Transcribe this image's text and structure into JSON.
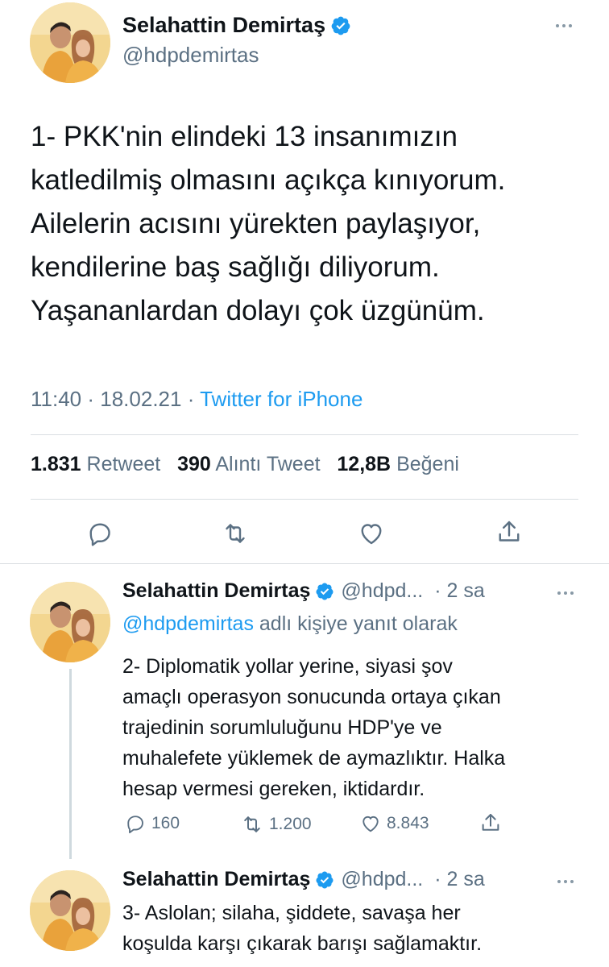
{
  "main_tweet": {
    "display_name": "Selahattin Demirtaş",
    "handle": "@hdpdemirtas",
    "text": "1- PKK'nin elindeki 13 insanımızın\nkatledilmiş olmasını açıkça kınıyorum.\nAilelerin acısını yürekten paylaşıyor,\nkendilerine baş sağlığı diliyorum.\nYaşananlardan dolayı çok üzgünüm.",
    "time": "11:40",
    "separator1": " · ",
    "date": "18.02.21",
    "separator2": " · ",
    "source": "Twitter for iPhone",
    "stats": {
      "retweets_count": "1.831",
      "retweets_label": "Retweet",
      "quotes_count": "390",
      "quotes_label": "Alıntı Tweet",
      "likes_count": "12,8B",
      "likes_label": "Beğeni"
    }
  },
  "replies": [
    {
      "display_name": "Selahattin Demirtaş",
      "handle": "@hdpd...",
      "time": "· 2 sa",
      "reply_to_handle": "@hdpdemirtas",
      "reply_to_suffix": " adlı kişiye yanıt olarak",
      "text": "2- Diplomatik yollar yerine, siyasi şov\namaçlı operasyon sonucunda ortaya çıkan\ntrajedinin sorumluluğunu HDP'ye ve\nmuhalefete yüklemek de aymazlıktır. Halka\nhesap vermesi gereken, iktidardır.",
      "reply_count": "160",
      "retweet_count": "1.200",
      "like_count": "8.843"
    },
    {
      "display_name": "Selahattin Demirtaş",
      "handle": "@hdpd...",
      "time": "· 2 sa",
      "text": "3- Aslolan; silaha, şiddete, savaşa her\nkoşulda karşı çıkarak barışı sağlamaktır."
    }
  ],
  "icons": {
    "verified": "verified-badge-icon",
    "more": "more-dots-icon",
    "reply": "comment-icon",
    "retweet": "retweet-icon",
    "like": "heart-icon",
    "share": "share-icon"
  },
  "colors": {
    "accent": "#1d9bf0",
    "muted": "#5b7083",
    "text": "#0f1419",
    "divider": "#d9dee2"
  }
}
